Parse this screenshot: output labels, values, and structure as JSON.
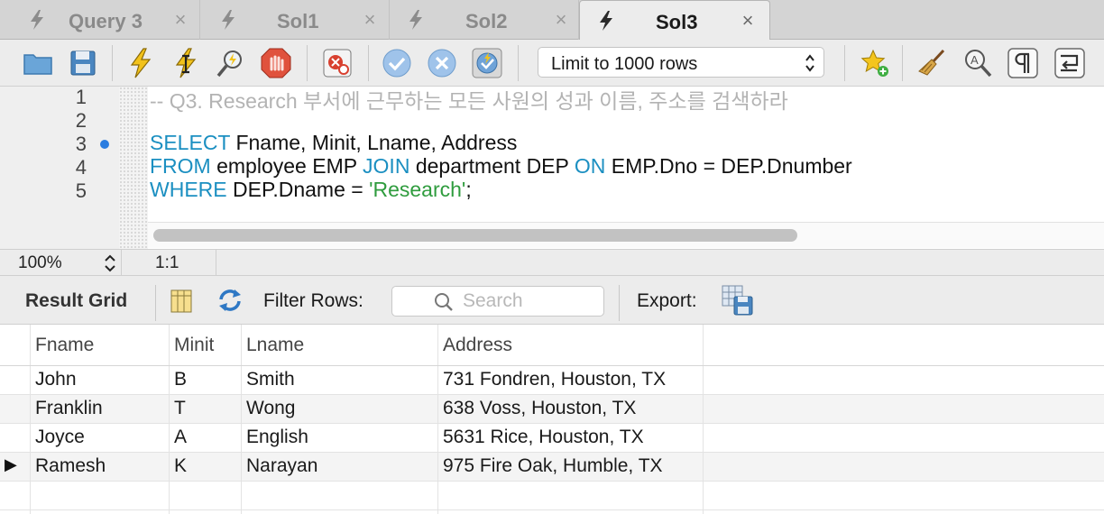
{
  "tabs": [
    {
      "label": "Query 3",
      "close": "×",
      "active": false
    },
    {
      "label": "Sol1",
      "close": "×",
      "active": false
    },
    {
      "label": "Sol2",
      "close": "×",
      "active": false
    },
    {
      "label": "Sol3",
      "close": "×",
      "active": true
    }
  ],
  "toolbar": {
    "limit_select": {
      "value": "Limit to 1000 rows"
    }
  },
  "editor": {
    "line_numbers": [
      "1",
      "2",
      "3",
      "4",
      "5"
    ],
    "lines": {
      "l1": {
        "comment": "-- Q3. Research 부서에 근무하는 모든 사원의 성과 이름, 주소를 검색하라"
      },
      "l3": {
        "kw": "SELECT",
        "rest": " Fname, Minit, Lname, Address"
      },
      "l4": {
        "kw1": "FROM",
        "mid1": " employee EMP ",
        "kw2": "JOIN",
        "mid2": " department DEP ",
        "kw3": "ON",
        "rest": " EMP.Dno = DEP.Dnumber"
      },
      "l5": {
        "kw": "WHERE",
        "mid": " DEP.Dname = ",
        "str": "'Research'",
        "end": ";"
      }
    },
    "accent_colors": {
      "keyword": "#1b8fc1",
      "string": "#2f9c3e",
      "comment": "#b3b3b3",
      "breakpoint": "#2b7de0"
    }
  },
  "status": {
    "zoom": "100%",
    "cursor": "1:1"
  },
  "results": {
    "tab_label": "Result Grid",
    "filter_label": "Filter Rows:",
    "search_placeholder": "Search",
    "export_label": "Export:",
    "columns": [
      "Fname",
      "Minit",
      "Lname",
      "Address"
    ],
    "rows": [
      [
        "John",
        "B",
        "Smith",
        "731 Fondren, Houston, TX"
      ],
      [
        "Franklin",
        "T",
        "Wong",
        "638 Voss, Houston, TX"
      ],
      [
        "Joyce",
        "A",
        "English",
        "5631 Rice, Houston, TX"
      ],
      [
        "Ramesh",
        "K",
        "Narayan",
        "975 Fire Oak, Humble, TX"
      ]
    ],
    "current_row_marker": "▶"
  }
}
